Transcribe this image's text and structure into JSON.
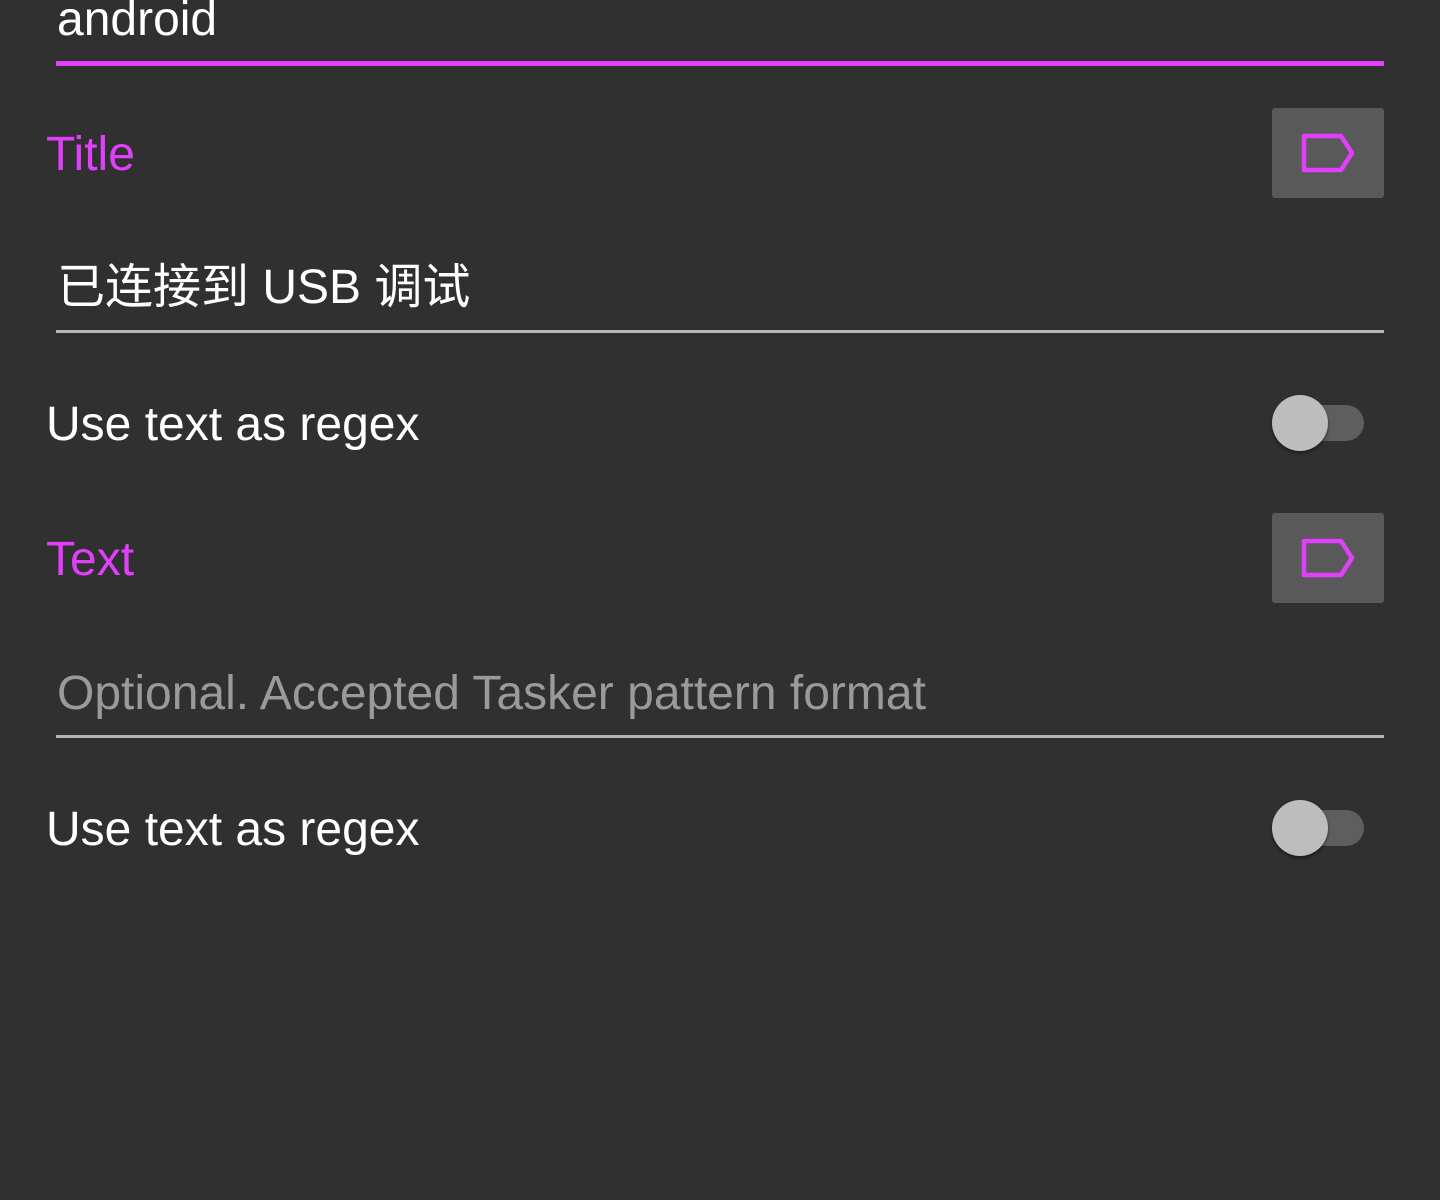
{
  "colors": {
    "background": "#303030",
    "accent": "#e040fb",
    "tag_button_bg": "#595959",
    "underline": "#b6b6b6"
  },
  "package_field": {
    "value": "android"
  },
  "title_section": {
    "label": "Title",
    "tag_button_icon": "label-tag-icon",
    "value": "已连接到 USB 调试",
    "regex_label": "Use text as regex",
    "regex_enabled": false
  },
  "text_section": {
    "label": "Text",
    "tag_button_icon": "label-tag-icon",
    "placeholder": "Optional. Accepted Tasker pattern format",
    "regex_label": "Use text as regex",
    "regex_enabled": false
  }
}
